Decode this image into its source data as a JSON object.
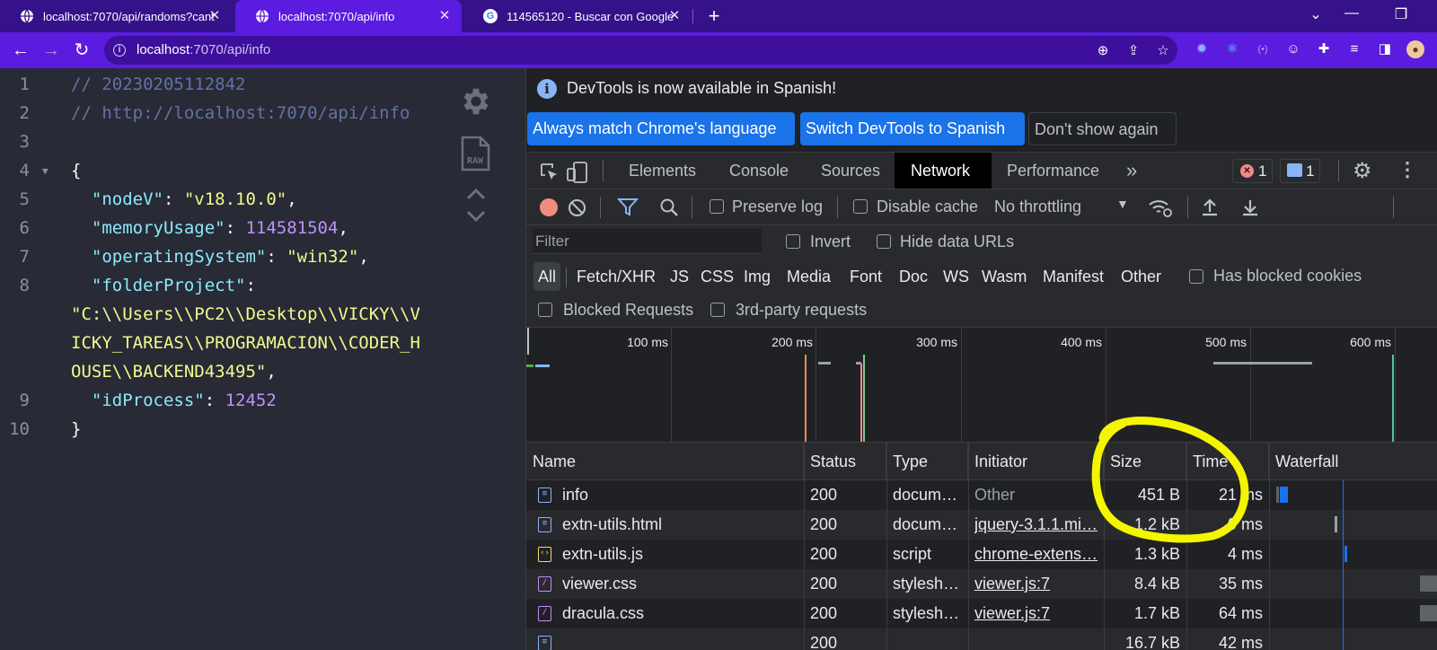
{
  "browser": {
    "tabs": [
      {
        "title": "localhost:7070/api/randoms?cant",
        "active": false,
        "icon": "globe-icon"
      },
      {
        "title": "localhost:7070/api/info",
        "active": true,
        "icon": "globe-icon"
      },
      {
        "title": "114565120 - Buscar con Google",
        "active": false,
        "icon": "google-icon"
      }
    ],
    "url_host": "localhost",
    "url_path": ":7070/api/info"
  },
  "json_viewer": {
    "lines": [
      {
        "n": "1",
        "tokens": [
          {
            "t": "// 20230205112842",
            "c": "comment"
          }
        ]
      },
      {
        "n": "2",
        "tokens": [
          {
            "t": "// http://localhost:7070/api/info",
            "c": "comment"
          }
        ]
      },
      {
        "n": "3",
        "tokens": []
      },
      {
        "n": "4",
        "fold": true,
        "tokens": [
          {
            "t": "{",
            "c": "punct"
          }
        ]
      },
      {
        "n": "5",
        "tokens": [
          {
            "t": "  \"nodeV\"",
            "c": "key"
          },
          {
            "t": ": ",
            "c": "punct"
          },
          {
            "t": "\"v18.10.0\"",
            "c": "str"
          },
          {
            "t": ",",
            "c": "punct"
          }
        ]
      },
      {
        "n": "6",
        "tokens": [
          {
            "t": "  \"memoryUsage\"",
            "c": "key"
          },
          {
            "t": ": ",
            "c": "punct"
          },
          {
            "t": "114581504",
            "c": "num"
          },
          {
            "t": ",",
            "c": "punct"
          }
        ]
      },
      {
        "n": "7",
        "tokens": [
          {
            "t": "  \"operatingSystem\"",
            "c": "key"
          },
          {
            "t": ": ",
            "c": "punct"
          },
          {
            "t": "\"win32\"",
            "c": "str"
          },
          {
            "t": ",",
            "c": "punct"
          }
        ]
      },
      {
        "n": "8",
        "tokens": [
          {
            "t": "  \"folderProject\"",
            "c": "key"
          },
          {
            "t": ":",
            "c": "punct"
          }
        ]
      },
      {
        "n": "",
        "tokens": [
          {
            "t": "\"C:\\\\Users\\\\PC2\\\\Desktop\\\\VICKY\\\\V",
            "c": "str"
          }
        ]
      },
      {
        "n": "",
        "tokens": [
          {
            "t": "ICKY_TAREAS\\\\PROGRAMACION\\\\CODER_H",
            "c": "str"
          }
        ]
      },
      {
        "n": "",
        "tokens": [
          {
            "t": "OUSE\\\\BACKEND43495\"",
            "c": "str"
          },
          {
            "t": ",",
            "c": "punct"
          }
        ]
      },
      {
        "n": "9",
        "tokens": [
          {
            "t": "  \"idProcess\"",
            "c": "key"
          },
          {
            "t": ": ",
            "c": "punct"
          },
          {
            "t": "12452",
            "c": "num"
          }
        ]
      },
      {
        "n": "10",
        "tokens": [
          {
            "t": "}",
            "c": "punct"
          }
        ]
      }
    ],
    "raw_label": "RAW"
  },
  "devtools": {
    "infobar_message": "DevTools is now available in Spanish!",
    "btn_match": "Always match Chrome's language",
    "btn_switch": "Switch DevTools to Spanish",
    "btn_dismiss": "Don't show again",
    "panel_tabs": [
      "Elements",
      "Console",
      "Sources",
      "Network",
      "Performance"
    ],
    "active_panel": "Network",
    "more_tabs": "»",
    "error_count": "1",
    "message_count": "1",
    "preserve_log": "Preserve log",
    "disable_cache": "Disable cache",
    "throttling": "No throttling",
    "filter_placeholder": "Filter",
    "invert": "Invert",
    "hide_data_urls": "Hide data URLs",
    "type_filters": [
      "All",
      "Fetch/XHR",
      "JS",
      "CSS",
      "Img",
      "Media",
      "Font",
      "Doc",
      "WS",
      "Wasm",
      "Manifest",
      "Other"
    ],
    "active_type": "All",
    "has_blocked_cookies": "Has blocked cookies",
    "blocked_requests": "Blocked Requests",
    "third_party": "3rd-party requests",
    "overview_ticks": [
      "100 ms",
      "200 ms",
      "300 ms",
      "400 ms",
      "500 ms",
      "600 ms"
    ],
    "columns": {
      "name": "Name",
      "status": "Status",
      "type": "Type",
      "initiator": "Initiator",
      "size": "Size",
      "time": "Time",
      "waterfall": "Waterfall"
    },
    "requests": [
      {
        "name": "info",
        "status": "200",
        "type": "docum…",
        "initiator": "Other",
        "initiator_link": false,
        "size": "451 B",
        "time": "21 ms",
        "icon": "document-icon"
      },
      {
        "name": "extn-utils.html",
        "status": "200",
        "type": "docum…",
        "initiator": "jquery-3.1.1.mi…",
        "initiator_link": true,
        "size": "1.2 kB",
        "time": "9 ms",
        "icon": "document-icon"
      },
      {
        "name": "extn-utils.js",
        "status": "200",
        "type": "script",
        "initiator": "chrome-extens…",
        "initiator_link": true,
        "size": "1.3 kB",
        "time": "4 ms",
        "icon": "script-icon"
      },
      {
        "name": "viewer.css",
        "status": "200",
        "type": "stylesh…",
        "initiator": "viewer.js:7",
        "initiator_link": true,
        "size": "8.4 kB",
        "time": "35 ms",
        "icon": "stylesheet-icon"
      },
      {
        "name": "dracula.css",
        "status": "200",
        "type": "stylesh…",
        "initiator": "viewer.js:7",
        "initiator_link": true,
        "size": "1.7 kB",
        "time": "64 ms",
        "icon": "stylesheet-icon"
      },
      {
        "name": "",
        "status": "200",
        "type": "",
        "initiator": "",
        "initiator_link": true,
        "size": "16.7 kB",
        "time": "42 ms",
        "icon": "document-icon"
      }
    ]
  },
  "colors": {
    "tabstrip": "#35128a",
    "toolbar": "#5b1ce0",
    "annotation": "#f5f500",
    "primary_button": "#1a73e8"
  }
}
